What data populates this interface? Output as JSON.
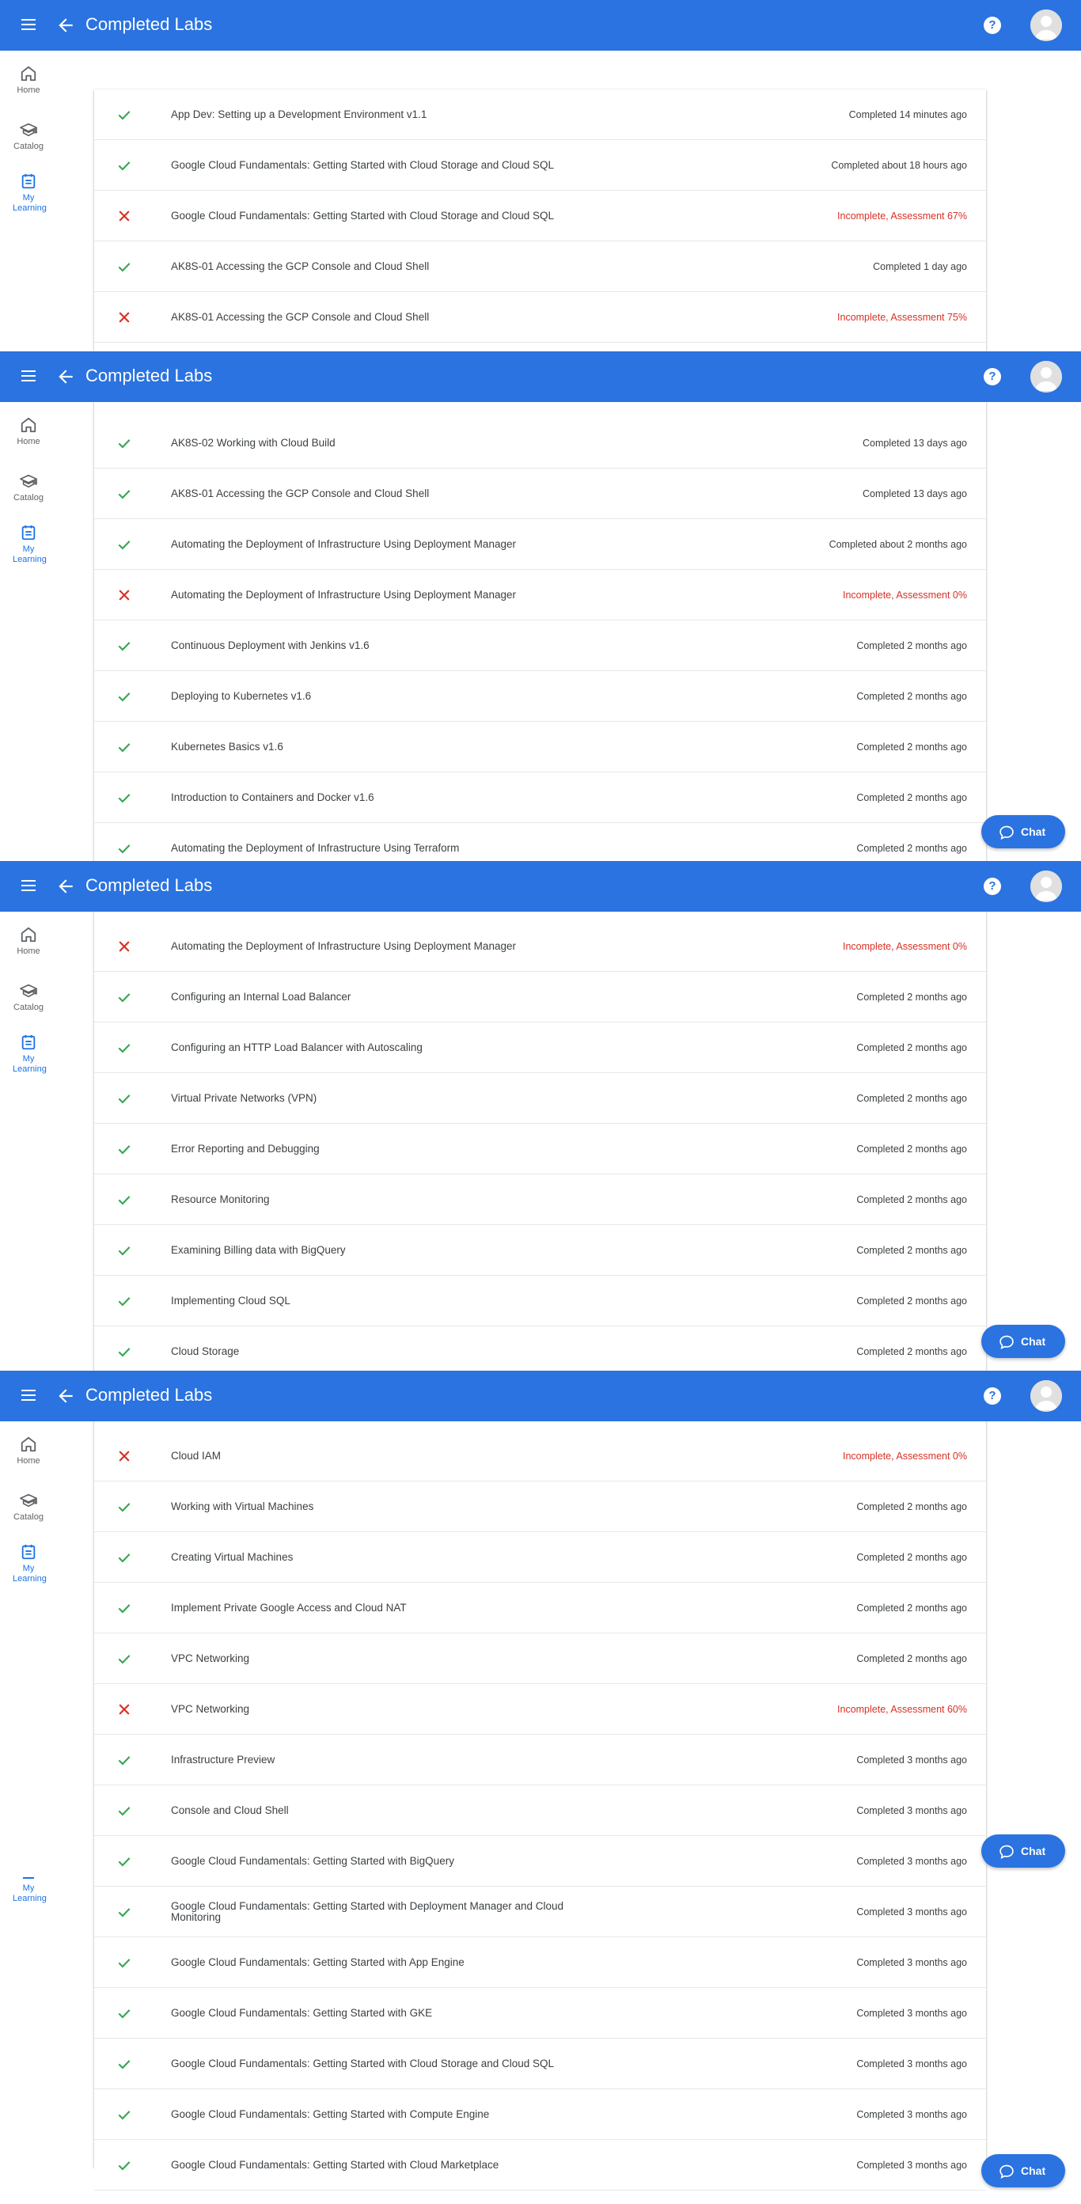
{
  "app_bar": {
    "title": "Completed Labs",
    "help_glyph": "?"
  },
  "nav": {
    "home": "Home",
    "catalog": "Catalog",
    "my_learning": "My Learning"
  },
  "chat": {
    "label": "Chat"
  },
  "colors": {
    "brand": "#2a73e0",
    "success": "#34a853",
    "failure": "#d93025",
    "nav_active": "#1a73e8"
  },
  "screens": [
    {
      "rows": [
        {
          "ok": true,
          "name": "App Dev: Setting up a Development Environment v1.1",
          "status": "Completed 14 minutes ago"
        },
        {
          "ok": true,
          "name": "Google Cloud Fundamentals: Getting Started with Cloud Storage and Cloud SQL",
          "status": "Completed about 18 hours ago"
        },
        {
          "ok": false,
          "name": "Google Cloud Fundamentals: Getting Started with Cloud Storage and Cloud SQL",
          "status": "Incomplete, Assessment 67%"
        },
        {
          "ok": true,
          "name": "AK8S-01 Accessing the GCP Console and Cloud Shell",
          "status": "Completed 1 day ago"
        },
        {
          "ok": false,
          "name": "AK8S-01 Accessing the GCP Console and Cloud Shell",
          "status": "Incomplete, Assessment 75%"
        }
      ]
    },
    {
      "rows": [
        {
          "ok": true,
          "name": "AK8S-02 Working with Cloud Build",
          "status": "Completed 13 days ago"
        },
        {
          "ok": true,
          "name": "AK8S-01 Accessing the GCP Console and Cloud Shell",
          "status": "Completed 13 days ago"
        },
        {
          "ok": true,
          "name": "Automating the Deployment of Infrastructure Using Deployment Manager",
          "status": "Completed about 2 months ago"
        },
        {
          "ok": false,
          "name": "Automating the Deployment of Infrastructure Using Deployment Manager",
          "status": "Incomplete, Assessment 0%"
        },
        {
          "ok": true,
          "name": "Continuous Deployment with Jenkins v1.6",
          "status": "Completed 2 months ago"
        },
        {
          "ok": true,
          "name": "Deploying to Kubernetes v1.6",
          "status": "Completed 2 months ago"
        },
        {
          "ok": true,
          "name": "Kubernetes Basics v1.6",
          "status": "Completed 2 months ago"
        },
        {
          "ok": true,
          "name": "Introduction to Containers and Docker v1.6",
          "status": "Completed 2 months ago"
        },
        {
          "ok": true,
          "name": "Automating the Deployment of Infrastructure Using Terraform",
          "status": "Completed 2 months ago"
        }
      ]
    },
    {
      "rows": [
        {
          "ok": false,
          "name": "Automating the Deployment of Infrastructure Using Deployment Manager",
          "status": "Incomplete, Assessment 0%"
        },
        {
          "ok": true,
          "name": "Configuring an Internal Load Balancer",
          "status": "Completed 2 months ago"
        },
        {
          "ok": true,
          "name": "Configuring an HTTP Load Balancer with Autoscaling",
          "status": "Completed 2 months ago"
        },
        {
          "ok": true,
          "name": "Virtual Private Networks (VPN)",
          "status": "Completed 2 months ago"
        },
        {
          "ok": true,
          "name": "Error Reporting and Debugging",
          "status": "Completed 2 months ago"
        },
        {
          "ok": true,
          "name": "Resource Monitoring",
          "status": "Completed 2 months ago"
        },
        {
          "ok": true,
          "name": "Examining Billing data with BigQuery",
          "status": "Completed 2 months ago"
        },
        {
          "ok": true,
          "name": "Implementing Cloud SQL",
          "status": "Completed 2 months ago"
        },
        {
          "ok": true,
          "name": "Cloud Storage",
          "status": "Completed 2 months ago"
        }
      ]
    },
    {
      "rows": [
        {
          "ok": false,
          "name": "Cloud IAM",
          "status": "Incomplete, Assessment 0%"
        },
        {
          "ok": true,
          "name": "Working with Virtual Machines",
          "status": "Completed 2 months ago"
        },
        {
          "ok": true,
          "name": "Creating Virtual Machines",
          "status": "Completed 2 months ago"
        },
        {
          "ok": true,
          "name": "Implement Private Google Access and Cloud NAT",
          "status": "Completed 2 months ago"
        },
        {
          "ok": true,
          "name": "VPC Networking",
          "status": "Completed 2 months ago"
        },
        {
          "ok": false,
          "name": "VPC Networking",
          "status": "Incomplete, Assessment 60%"
        },
        {
          "ok": true,
          "name": "Infrastructure Preview",
          "status": "Completed 3 months ago"
        },
        {
          "ok": true,
          "name": "Console and Cloud Shell",
          "status": "Completed 3 months ago"
        },
        {
          "ok": true,
          "name": "Google Cloud Fundamentals: Getting Started with BigQuery",
          "status": "Completed 3 months ago"
        },
        {
          "ok": true,
          "name": "Google Cloud Fundamentals: Getting Started with Deployment Manager and Cloud Monitoring",
          "status": "Completed 3 months ago"
        },
        {
          "ok": true,
          "name": "Google Cloud Fundamentals: Getting Started with App Engine",
          "status": "Completed 3 months ago"
        },
        {
          "ok": true,
          "name": "Google Cloud Fundamentals: Getting Started with GKE",
          "status": "Completed 3 months ago"
        },
        {
          "ok": true,
          "name": "Google Cloud Fundamentals: Getting Started with Cloud Storage and Cloud SQL",
          "status": "Completed 3 months ago"
        },
        {
          "ok": true,
          "name": "Google Cloud Fundamentals: Getting Started with Compute Engine",
          "status": "Completed 3 months ago"
        },
        {
          "ok": true,
          "name": "Google Cloud Fundamentals: Getting Started with Cloud Marketplace",
          "status": "Completed 3 months ago"
        }
      ]
    }
  ]
}
